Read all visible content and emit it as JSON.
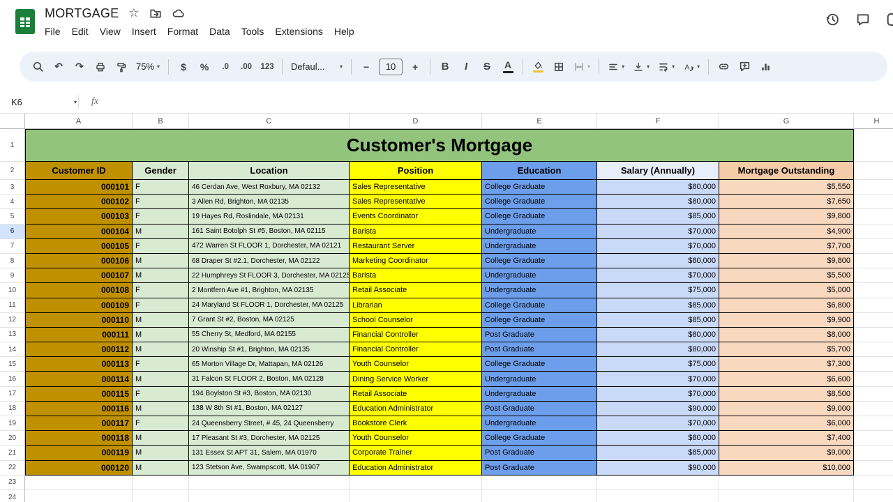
{
  "app": {
    "product": "Google Sheets",
    "title": "MORTGAGE",
    "menus": [
      "File",
      "Edit",
      "View",
      "Insert",
      "Format",
      "Data",
      "Tools",
      "Extensions",
      "Help"
    ]
  },
  "toolbar": {
    "zoom": "75%",
    "currency": "$",
    "percent": "%",
    "decrease_decimals": ".0",
    "increase_decimals": ".00",
    "more_formats": "123",
    "font": "Defaul...",
    "font_size": "10",
    "decrease_font": "−",
    "increase_font": "+",
    "bold": "B",
    "italic": "I",
    "strikethrough": "S",
    "text_color": "A"
  },
  "formula_bar": {
    "cell_ref": "K6",
    "fx_label": "fx"
  },
  "grid": {
    "col_letters": [
      "A",
      "B",
      "C",
      "D",
      "E",
      "F",
      "G",
      "H"
    ],
    "row_count": 24,
    "active_row": 6,
    "title": "Customer's Mortgage",
    "column_headers": [
      "Customer ID",
      "Gender",
      "Location",
      "Position",
      "Education",
      "Salary (Annually)",
      "Mortgage Outstanding"
    ],
    "rows": [
      [
        "000101",
        "F",
        "46 Cerdan Ave, West Roxbury, MA 02132",
        "Sales Representative",
        "College Graduate",
        "$80,000",
        "$5,550"
      ],
      [
        "000102",
        "F",
        "3 Allen Rd, Brighton, MA 02135",
        "Sales Representative",
        "College Graduate",
        "$80,000",
        "$7,650"
      ],
      [
        "000103",
        "F",
        "19 Hayes Rd, Roslindale, MA 02131",
        "Events Coordinator",
        "College Graduate",
        "$85,000",
        "$9,800"
      ],
      [
        "000104",
        "M",
        "161 Saint Botolph St #5, Boston, MA 02115",
        "Barista",
        "Undergraduate",
        "$70,000",
        "$4,900"
      ],
      [
        "000105",
        "F",
        "472 Warren St FLOOR 1, Dorchester, MA 02121",
        "Restaurant Server",
        "Undergraduate",
        "$70,000",
        "$7,700"
      ],
      [
        "000106",
        "M",
        "68 Draper St #2.1, Dorchester, MA 02122",
        "Marketing Coordinator",
        "College Graduate",
        "$80,000",
        "$9,800"
      ],
      [
        "000107",
        "M",
        "22 Humphreys St FLOOR 3, Dorchester, MA 02125",
        "Barista",
        "Undergraduate",
        "$70,000",
        "$5,500"
      ],
      [
        "000108",
        "F",
        "2 Montfern Ave #1, Brighton, MA 02135",
        "Retail Associate",
        "Undergraduate",
        "$75,000",
        "$5,000"
      ],
      [
        "000109",
        "F",
        "24 Maryland St FLOOR 1, Dorchester, MA 02125",
        "Librarian",
        "College Graduate",
        "$85,000",
        "$6,800"
      ],
      [
        "000110",
        "M",
        "7 Grant St #2, Boston, MA 02125",
        "School Counselor",
        "College Graduate",
        "$85,000",
        "$9,900"
      ],
      [
        "000111",
        "M",
        "55 Cherry St, Medford, MA 02155",
        "Financial Controller",
        "Post Graduate",
        "$80,000",
        "$8,000"
      ],
      [
        "000112",
        "M",
        "20 Winship St #1, Brighton, MA 02135",
        "Financial Controller",
        "Post Graduate",
        "$80,000",
        "$5,700"
      ],
      [
        "000113",
        "F",
        "65 Morton Village Dr, Mattapan, MA 02126",
        "Youth Counselor",
        "College Graduate",
        "$75,000",
        "$7,300"
      ],
      [
        "000114",
        "M",
        "31 Falcon St FLOOR 2, Boston, MA 02128",
        "Dining Service Worker",
        "Undergraduate",
        "$70,000",
        "$6,600"
      ],
      [
        "000115",
        "F",
        "194 Boylston St #3, Boston, MA 02130",
        "Retail Associate",
        "Undergraduate",
        "$70,000",
        "$8,500"
      ],
      [
        "000116",
        "M",
        "138 W 8th St #1, Boston, MA 02127",
        "Education Administrator",
        "Post Graduate",
        "$90,000",
        "$9,000"
      ],
      [
        "000117",
        "F",
        "24 Queensberry Street, # 45, 24 Queensberry",
        "Bookstore Clerk",
        "Undergraduate",
        "$70,000",
        "$6,000"
      ],
      [
        "000118",
        "M",
        "17 Pleasant St #3, Dorchester, MA 02125",
        "Youth Counselor",
        "College Graduate",
        "$80,000",
        "$7,400"
      ],
      [
        "000119",
        "M",
        "131 Essex St APT 31, Salem, MA 01970",
        "Corporate Trainer",
        "Post Graduate",
        "$85,000",
        "$9,000"
      ],
      [
        "000120",
        "M",
        "123 Stetson Ave, Swampscott, MA 01907",
        "Education Administrator",
        "Post Graduate",
        "$90,000",
        "$10,000"
      ]
    ]
  },
  "colors": {
    "title_bg": "#93c47d",
    "customer_id_bg": "#bf9000",
    "gender_bg": "#d9ead3",
    "location_bg": "#d9ead3",
    "position_bg": "#ffff00",
    "education_bg": "#6d9eeb",
    "salary_header_bg": "#e8eef9",
    "salary_bg": "#c9daf8",
    "mortgage_header_bg": "#f6cba8",
    "mortgage_bg": "#f9d8c0",
    "active_row_bg": "#d3e3fd",
    "toolbar_bg": "#edf2fa",
    "logo_green": "#188038"
  }
}
